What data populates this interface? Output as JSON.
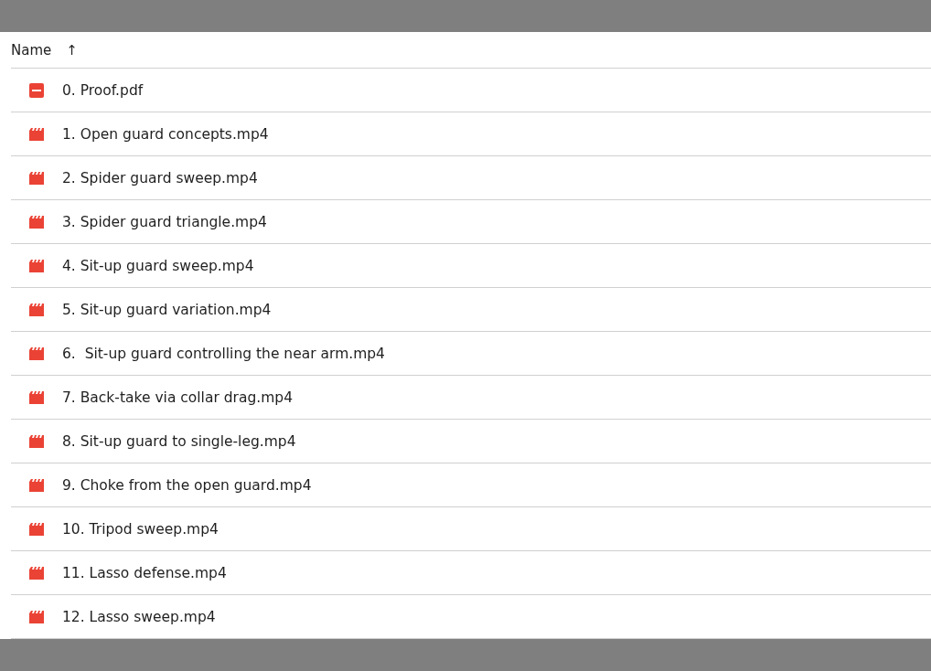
{
  "column_header": {
    "label": "Name",
    "sort_arrow": "↑"
  },
  "files": [
    {
      "kind": "pdf",
      "name": "0. Proof.pdf"
    },
    {
      "kind": "video",
      "name": "1. Open guard concepts.mp4"
    },
    {
      "kind": "video",
      "name": "2. Spider guard sweep.mp4"
    },
    {
      "kind": "video",
      "name": "3. Spider guard triangle.mp4"
    },
    {
      "kind": "video",
      "name": "4. Sit-up guard sweep.mp4"
    },
    {
      "kind": "video",
      "name": "5. Sit-up guard variation.mp4"
    },
    {
      "kind": "video",
      "name": "6.  Sit-up guard controlling the near arm.mp4"
    },
    {
      "kind": "video",
      "name": "7. Back-take via collar drag.mp4"
    },
    {
      "kind": "video",
      "name": "8. Sit-up guard to single-leg.mp4"
    },
    {
      "kind": "video",
      "name": "9. Choke from the open guard.mp4"
    },
    {
      "kind": "video",
      "name": "10. Tripod sweep.mp4"
    },
    {
      "kind": "video",
      "name": "11. Lasso defense.mp4"
    },
    {
      "kind": "video",
      "name": "12. Lasso sweep.mp4"
    }
  ]
}
